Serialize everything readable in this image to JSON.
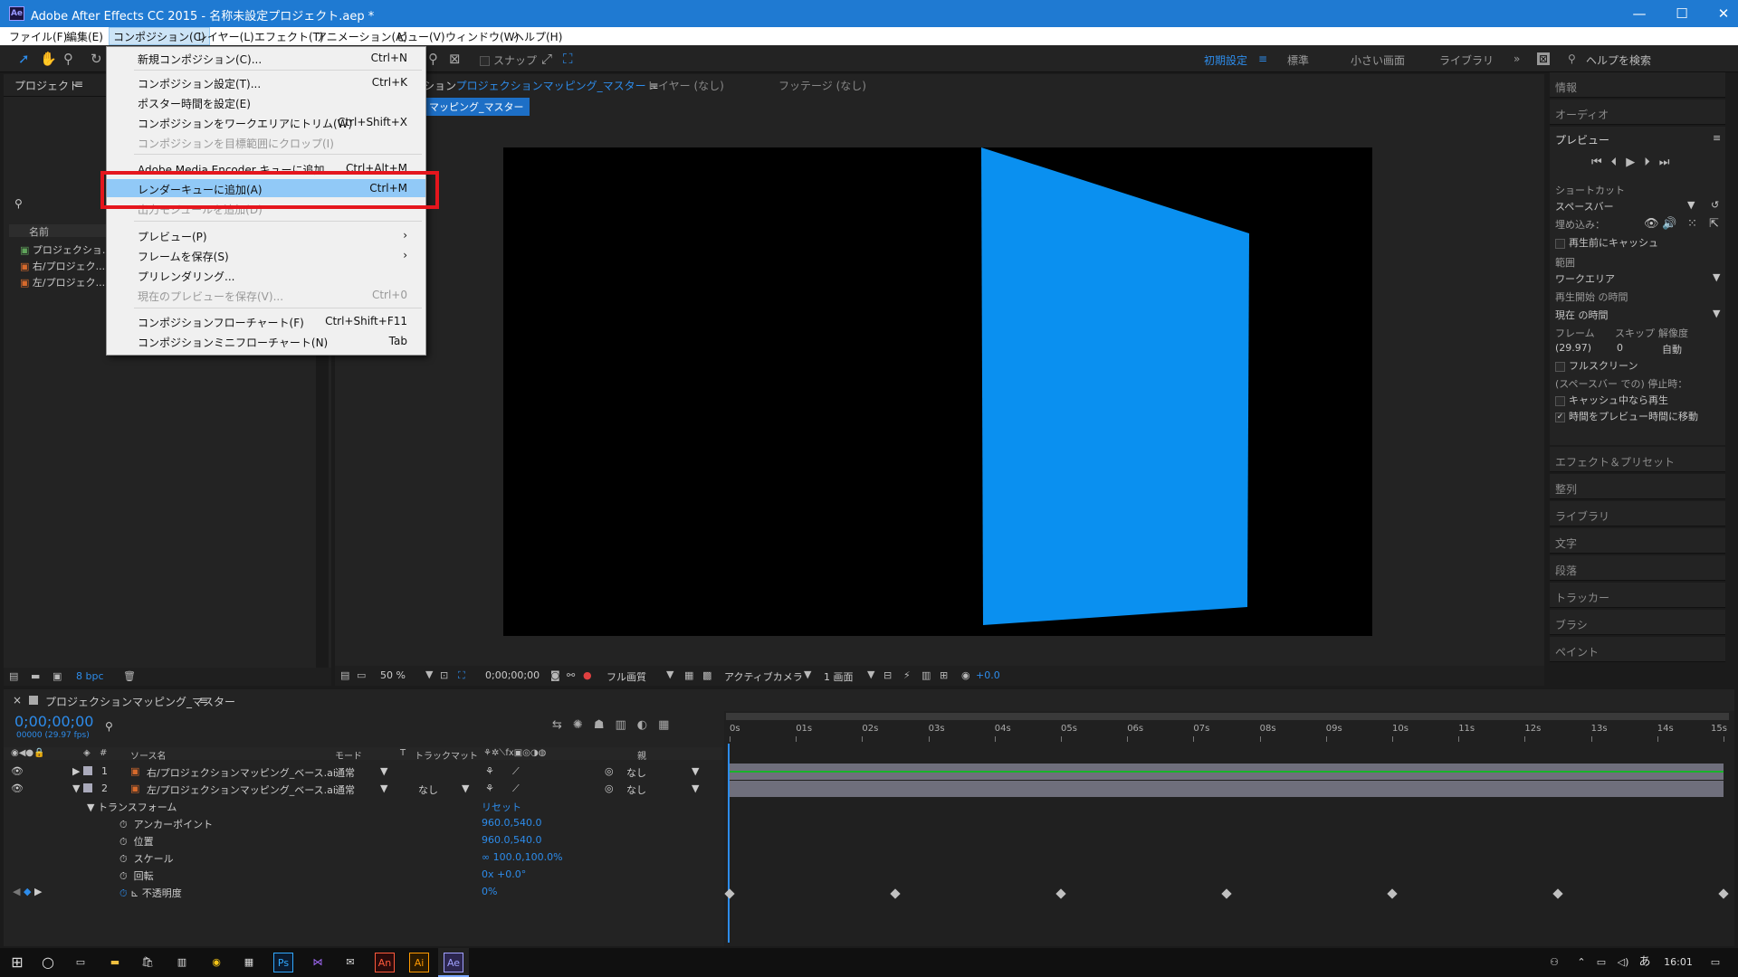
{
  "window": {
    "title": "Adobe After Effects CC 2015 - 名称未設定プロジェクト.aep *",
    "logo": "Ae",
    "min": "—",
    "max": "☐",
    "close": "✕"
  },
  "menu": [
    "ファイル(F)",
    "編集(E)",
    "コンポジション(C)",
    "レイヤー(L)",
    "エフェクト(T)",
    "アニメーション(A)",
    "ビュー(V)",
    "ウィンドウ(W)",
    "ヘルプ(H)"
  ],
  "toolbar": {
    "snap": "スナップ",
    "workspaces": [
      "初期設定",
      "標準",
      "小さい画面",
      "ライブラリ"
    ],
    "more": "»",
    "help_search": "ヘルプを検索"
  },
  "dropdown": {
    "items": [
      {
        "label": "新規コンポジション(C)...",
        "shortcut": "Ctrl+N",
        "state": "enabled"
      },
      {
        "label": "コンポジション設定(T)...",
        "shortcut": "Ctrl+K",
        "state": "enabled"
      },
      {
        "label": "ポスター時間を設定(E)",
        "shortcut": "",
        "state": "enabled"
      },
      {
        "label": "コンポジションをワークエリアにトリム(W)",
        "shortcut": "Ctrl+Shift+X",
        "state": "enabled"
      },
      {
        "label": "コンポジションを目標範囲にクロップ(I)",
        "shortcut": "",
        "state": "disabled"
      },
      {
        "label": "Adobe Media Encoder キューに追加...",
        "shortcut": "Ctrl+Alt+M",
        "state": "enabled"
      },
      {
        "label": "レンダーキューに追加(A)",
        "shortcut": "Ctrl+M",
        "state": "highlighted"
      },
      {
        "label": "出力モジュールを追加(D)",
        "shortcut": "",
        "state": "disabled"
      },
      {
        "label": "プレビュー(P)",
        "shortcut": "›",
        "state": "enabled"
      },
      {
        "label": "フレームを保存(S)",
        "shortcut": "›",
        "state": "enabled"
      },
      {
        "label": "プリレンダリング...",
        "shortcut": "",
        "state": "enabled"
      },
      {
        "label": "現在のプレビューを保存(V)...",
        "shortcut": "Ctrl+0",
        "state": "disabled"
      },
      {
        "label": "コンポジションフローチャート(F)",
        "shortcut": "Ctrl+Shift+F11",
        "state": "enabled"
      },
      {
        "label": "コンポジションミニフローチャート(N)",
        "shortcut": "Tab",
        "state": "enabled"
      }
    ]
  },
  "project": {
    "title": "プロジェクト",
    "col_name": "名前",
    "items": [
      "プロジェクショ...",
      "右/プロジェク...",
      "左/プロジェク..."
    ],
    "bpc": "8 bpc"
  },
  "comp": {
    "tab_prefix": "ション",
    "tab_name": "プロジェクションマッピング_マスター",
    "layer_tab": "レイヤー (なし)",
    "footage_tab": "フッテージ (なし)",
    "crumb": "マッピング_マスター",
    "zoom": "50 %",
    "timecode": "0;00;00;00",
    "quality": "フル画質",
    "camera": "アクティブカメラ",
    "views": "1 画面",
    "exposure": "+0.0",
    "shape_color": "#0a90f0"
  },
  "right": {
    "info": "情報",
    "audio": "オーディオ",
    "preview": "プレビュー",
    "shortcut_label": "ショートカット",
    "shortcut_value": "スペースバー",
    "include_label": "埋め込み：",
    "cache_before": "再生前にキャッシュ",
    "range_label": "範囲",
    "range_value": "ワークエリア",
    "start_label": "再生開始 の時間",
    "start_value": "現在 の時間",
    "frame_label": "フレーム",
    "skip_label": "スキップ",
    "res_label": "解像度",
    "frame_value": "(29.97)",
    "skip_value": "0",
    "res_value": "自動",
    "fullscreen": "フルスクリーン",
    "stop_label": "(スペースバー での) 停止時：",
    "cache_play": "キャッシュ中なら再生",
    "move_time": "時間をプレビュー時間に移動",
    "panels": [
      "エフェクト＆プリセット",
      "整列",
      "ライブラリ",
      "文字",
      "段落",
      "トラッカー",
      "ブラシ",
      "ペイント"
    ]
  },
  "timeline": {
    "comp_name": "プロジェクションマッピング_マスター",
    "timecode": "0;00;00;00",
    "fps": "00000 (29.97 fps)",
    "col_source": "ソース名",
    "col_mode": "モード",
    "col_t": "T",
    "col_trkmat": "トラックマット",
    "col_parent": "親",
    "layers": [
      {
        "num": "1",
        "name": "右/プロジェクションマッピング_ベース.ai",
        "mode": "通常",
        "trkmat": "",
        "parent": "なし"
      },
      {
        "num": "2",
        "name": "左/プロジェクションマッピング_ベース.ai",
        "mode": "通常",
        "trkmat": "なし",
        "parent": "なし"
      }
    ],
    "transform": "トランスフォーム",
    "reset": "リセット",
    "props": [
      {
        "name": "アンカーポイント",
        "value": "960.0,540.0"
      },
      {
        "name": "位置",
        "value": "960.0,540.0"
      },
      {
        "name": "スケール",
        "value": "100.0,100.0%"
      },
      {
        "name": "回転",
        "value": "0x +0.0°"
      },
      {
        "name": "不透明度",
        "value": "0%"
      }
    ],
    "ruler": [
      "0s",
      "01s",
      "02s",
      "03s",
      "04s",
      "05s",
      "06s",
      "07s",
      "08s",
      "09s",
      "10s",
      "11s",
      "12s",
      "13s",
      "14s",
      "15s"
    ],
    "keyframe_seconds": [
      0,
      2.5,
      5,
      7.5,
      10,
      12.5,
      15
    ]
  },
  "taskbar": {
    "clock": "16:01",
    "ime": "あ"
  }
}
